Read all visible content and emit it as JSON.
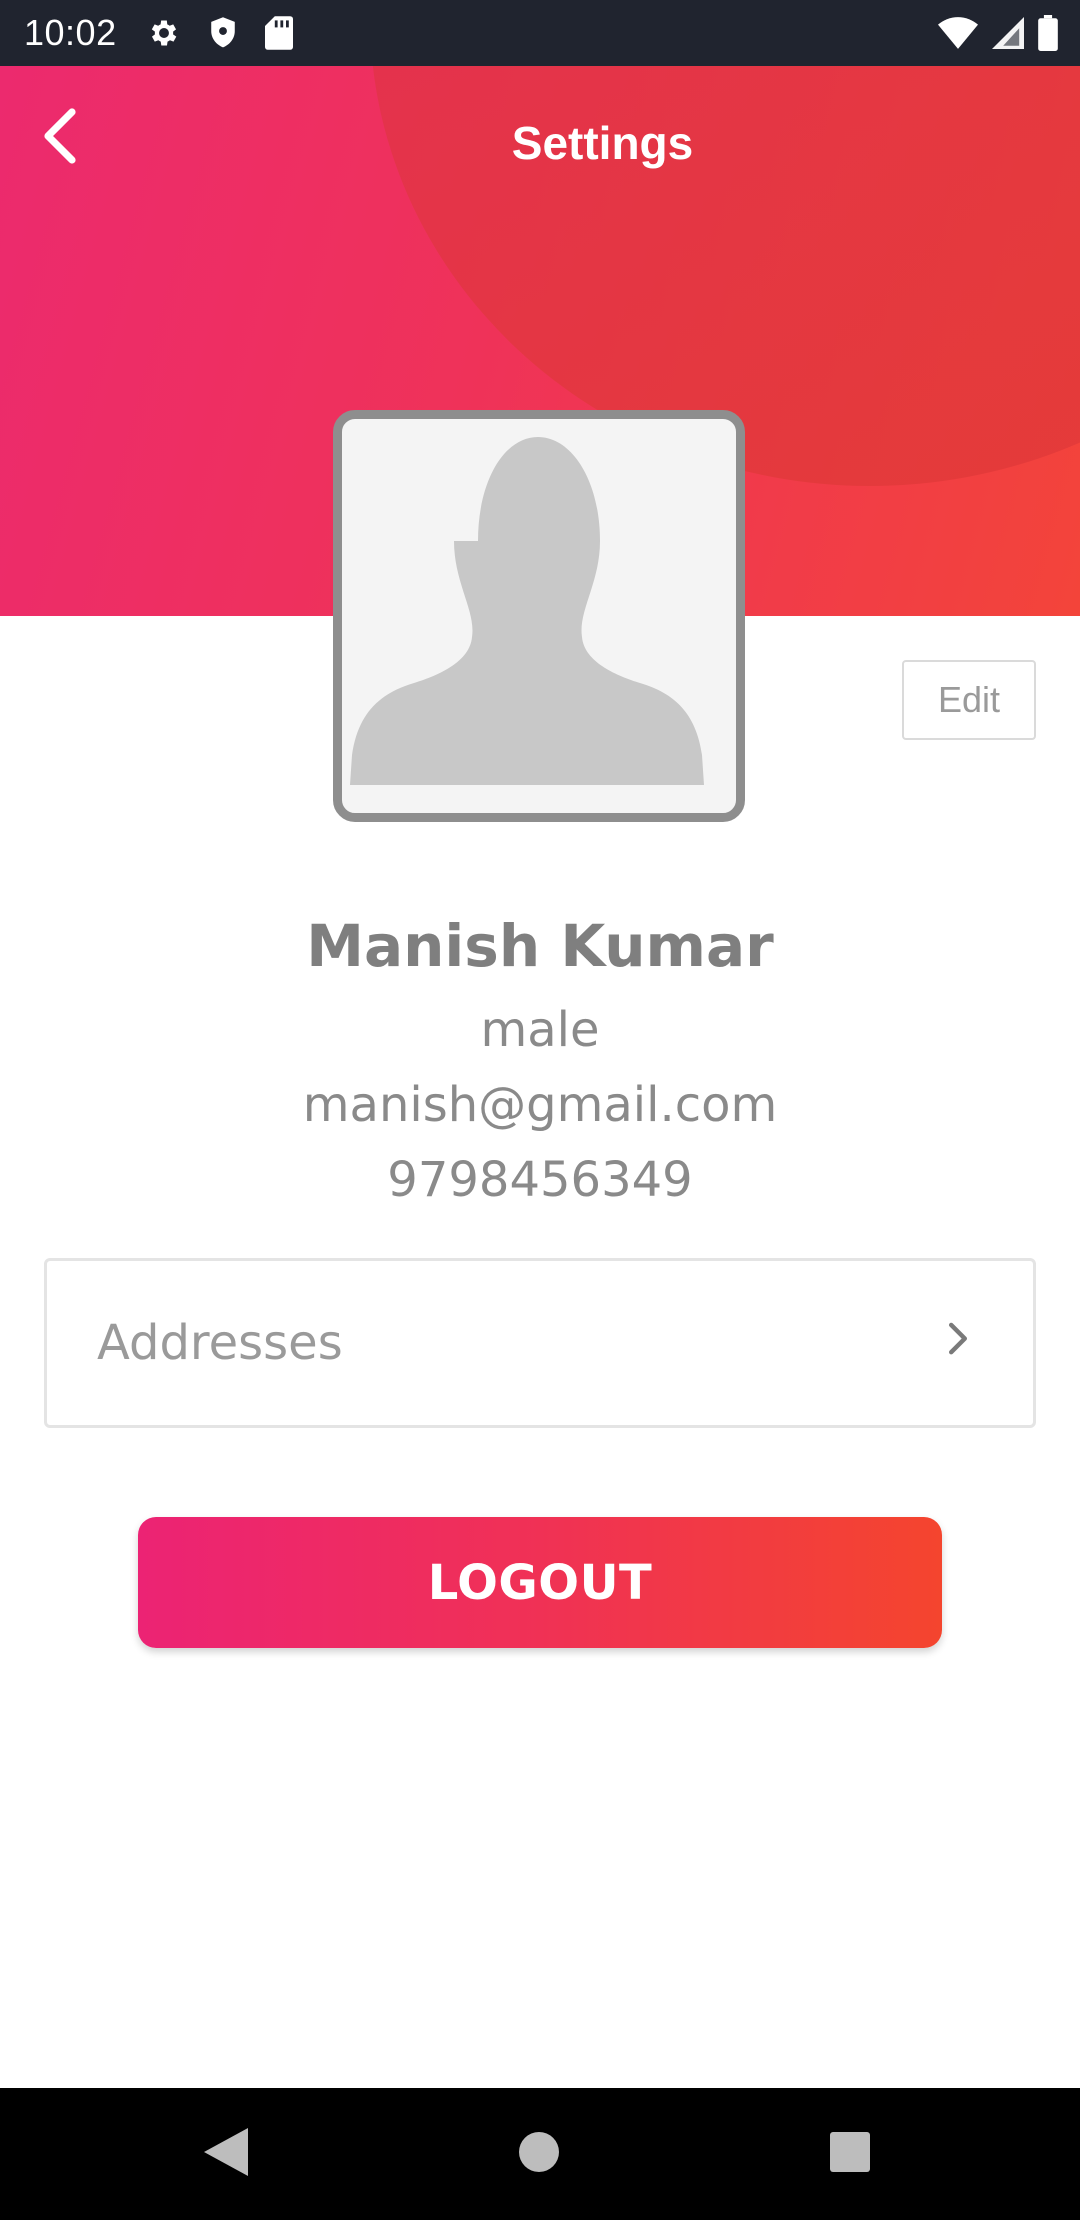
{
  "status_bar": {
    "time": "10:02",
    "left_icons": [
      "gear-icon",
      "shield-icon",
      "sd-card-icon"
    ],
    "right_icons": [
      "wifi-icon",
      "signal-icon",
      "battery-icon"
    ]
  },
  "header": {
    "title": "Settings",
    "back_icon": "chevron-left-icon",
    "gradient": [
      "#ec2a6e",
      "#f3443a"
    ]
  },
  "profile": {
    "avatar_icon": "person-placeholder-icon",
    "edit_label": "Edit",
    "name": "Manish Kumar",
    "gender": "male",
    "email": "manish@gmail.com",
    "phone": "9798456349"
  },
  "addresses": {
    "label": "Addresses",
    "icon": "chevron-right-icon"
  },
  "logout": {
    "label": "LOGOUT",
    "gradient": [
      "#ec2374",
      "#f4452e"
    ]
  },
  "nav_bar": {
    "buttons": [
      "back-triangle-icon",
      "home-circle-icon",
      "recents-square-icon"
    ]
  }
}
